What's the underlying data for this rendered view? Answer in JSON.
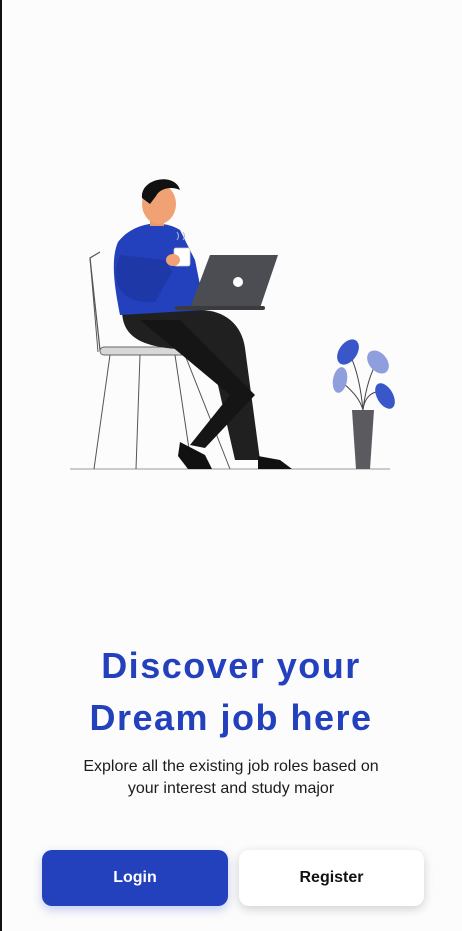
{
  "onboarding": {
    "title_line1": "Discover your",
    "title_line2": "Dream job here",
    "subtitle_line1": "Explore all the existing job roles based on",
    "subtitle_line2": "your interest and study major"
  },
  "actions": {
    "login_label": "Login",
    "register_label": "Register"
  },
  "colors": {
    "primary": "#2340bd",
    "background": "#fcfcfd",
    "text": "#1c1c1c"
  },
  "illustration": {
    "icon": "person-with-laptop-illustration"
  }
}
